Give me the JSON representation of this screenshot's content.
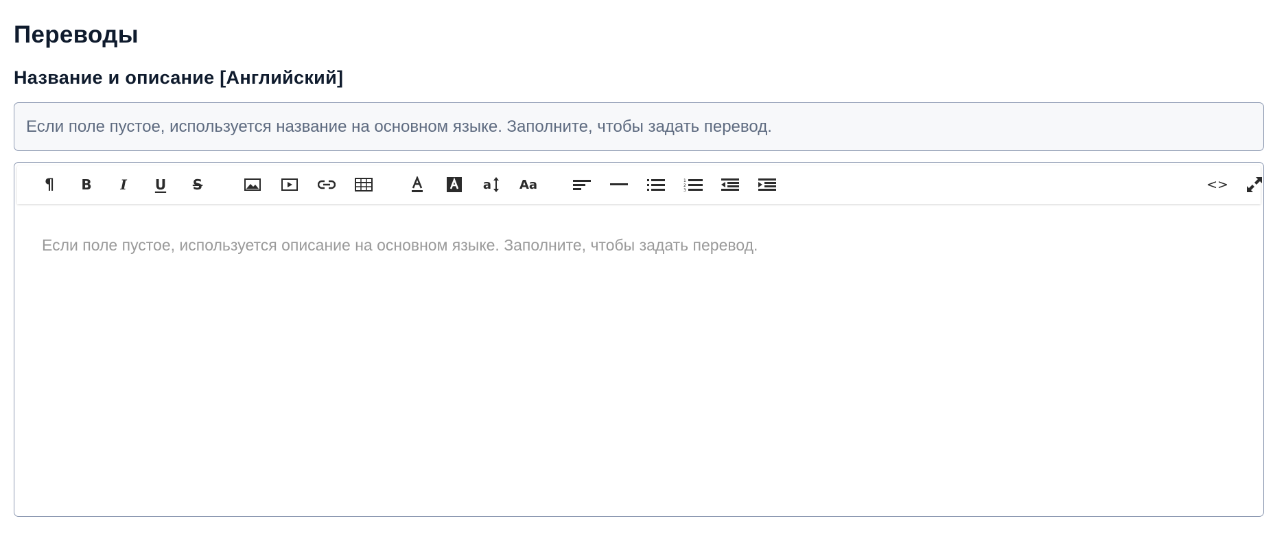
{
  "page": {
    "title": "Переводы",
    "section_title": "Название и описание [Английский]"
  },
  "name_field": {
    "value": "",
    "placeholder": "Если поле пустое, используется название на основном языке. Заполните, чтобы задать перевод."
  },
  "description_editor": {
    "placeholder": "Если поле пустое, используется описание на основном языке. Заполните, чтобы задать перевод.",
    "toolbar": {
      "paragraph": "¶",
      "bold": "B",
      "italic": "I",
      "underline": "U",
      "strikethrough": "S",
      "font_size": "a",
      "font_family": "Aa",
      "code_view": "<>"
    }
  }
}
